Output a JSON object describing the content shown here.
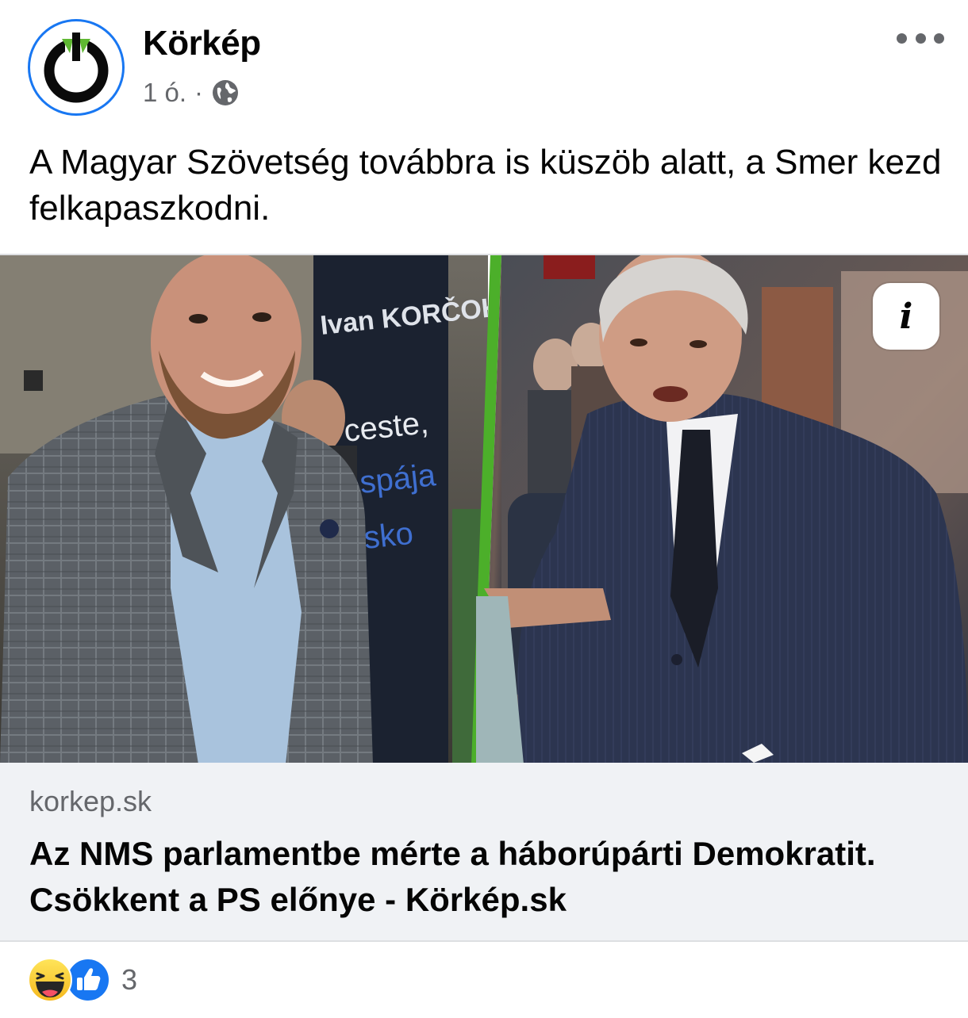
{
  "post": {
    "page_name": "Körkép",
    "time": "1 ó.",
    "separator": "·",
    "audience_icon": "globe-icon",
    "menu_icon": "more-horizontal-icon",
    "message": "A Magyar Szövetség továbbra is küszöb alatt, a Smer kezd felkapaszkodni.",
    "image_info_icon": "info-icon",
    "image_info_glyph": "i",
    "banner_texts": [
      "Ivan KORČOK",
      "ceste,",
      "spája",
      "sko"
    ]
  },
  "link": {
    "domain": "korkep.sk",
    "title": "Az NMS parlamentbe mérte a háborúpárti Demokratit. Csökkent a PS előnye - Körkép.sk"
  },
  "reactions": {
    "icons": [
      "haha-icon",
      "like-icon"
    ],
    "count": "3"
  },
  "colors": {
    "accent": "#1877f2",
    "split_line": "#4caf2a",
    "muted_text": "#65676b",
    "preview_bg": "#f0f2f5"
  }
}
